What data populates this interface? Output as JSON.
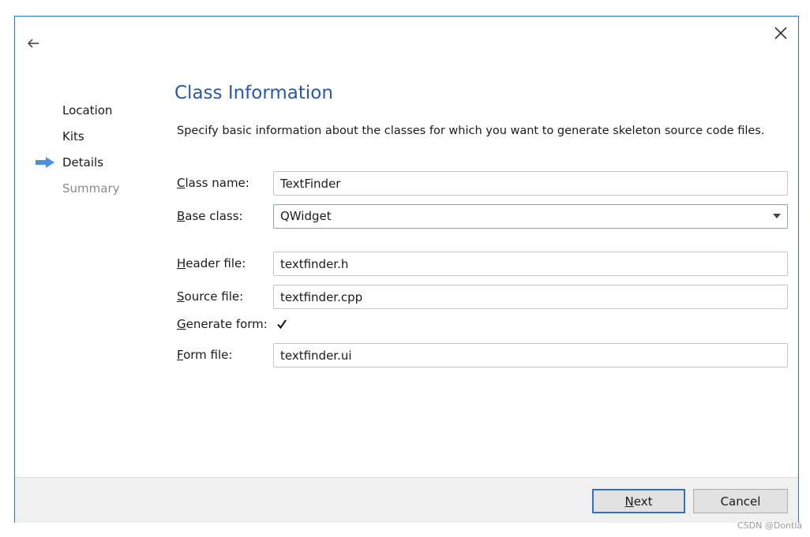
{
  "wizard": {
    "steps": [
      {
        "label": "Location",
        "state": "done"
      },
      {
        "label": "Kits",
        "state": "done"
      },
      {
        "label": "Details",
        "state": "current"
      },
      {
        "label": "Summary",
        "state": "pending"
      }
    ],
    "title": "Class Information",
    "description": "Specify basic information about the classes for which you want to generate skeleton source code files."
  },
  "form": {
    "class_name": {
      "label_mnemonic": "C",
      "label_rest": "lass name:",
      "value": "TextFinder"
    },
    "base_class": {
      "label_mnemonic": "B",
      "label_rest": "ase class:",
      "value": "QWidget"
    },
    "header_file": {
      "label_mnemonic": "H",
      "label_rest": "eader file:",
      "value": "textfinder.h"
    },
    "source_file": {
      "label_mnemonic": "S",
      "label_rest": "ource file:",
      "value": "textfinder.cpp"
    },
    "generate_form": {
      "label_mnemonic": "G",
      "label_rest": "enerate form:",
      "checked": true
    },
    "form_file": {
      "label_mnemonic": "F",
      "label_rest": "orm file:",
      "value": "textfinder.ui"
    }
  },
  "footer": {
    "next": {
      "mnemonic": "N",
      "rest": "ext"
    },
    "cancel_label": "Cancel"
  },
  "watermark": "CSDN @Dontla",
  "icons": {
    "back": "arrow-left-icon",
    "close": "close-icon",
    "current_step": "arrow-right-icon",
    "dropdown": "chevron-down-icon",
    "check": "checkmark-icon"
  },
  "colors": {
    "accent": "#2c72c7",
    "title": "#2b57a8",
    "step_arrow": "#4a90e2",
    "inactive_text": "#8a8a8a"
  }
}
